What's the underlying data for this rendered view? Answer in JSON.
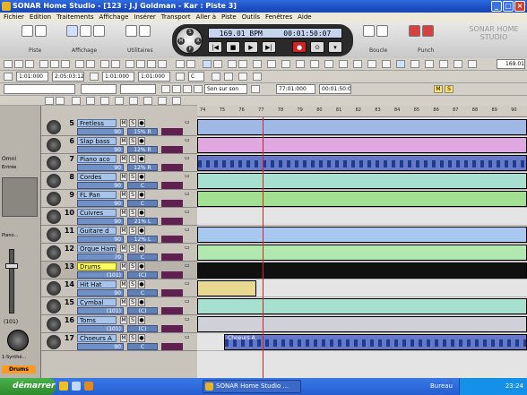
{
  "window": {
    "title": "SONAR Home Studio - [123 : J.J Goldman - Kar : Piste 3]"
  },
  "menu": [
    "Fichier",
    "Edition",
    "Traitements",
    "Affichage",
    "Insérer",
    "Transport",
    "Aller à",
    "Piste",
    "Outils",
    "Fenêtres",
    "Aide"
  ],
  "toolbar": {
    "groups": [
      {
        "label": "Piste"
      },
      {
        "label": "Affichage"
      },
      {
        "label": "Utilitaires"
      },
      {
        "label": "Boucle"
      },
      {
        "label": "Punch"
      }
    ],
    "brand": "SONAR HOME STUDIO"
  },
  "transport": {
    "tempo": "169.01 BPM",
    "time": "00:01:50:07",
    "knob_letters": [
      "S",
      "M",
      "R",
      "P"
    ]
  },
  "edit_row": {
    "field1": "1:01:000",
    "field2": "2:05:03:126",
    "field3": "1:01:000",
    "field4": "1:01:000",
    "field5": "C",
    "right_value": "169.01"
  },
  "row2": {
    "sound": "Son sur son",
    "time1": "77:01:000",
    "time2": "00:01:50:07",
    "mute_label": "M",
    "solo_label": "S"
  },
  "left_panel": {
    "label1": "Omni",
    "label2": "Entrée",
    "label3": "Piano...",
    "value_bottom": "(101)",
    "bottom_name": "1-Synthé...",
    "bottom_tag": "Drums"
  },
  "tracks": [
    {
      "num": "5",
      "name": "Fretless",
      "vol": "90",
      "pan": "15% R",
      "selected": false
    },
    {
      "num": "6",
      "name": "Slap bass",
      "vol": "90",
      "pan": "12% R",
      "selected": false
    },
    {
      "num": "7",
      "name": "Piano aco",
      "vol": "90",
      "pan": "12% R",
      "selected": false
    },
    {
      "num": "8",
      "name": "Cordes",
      "vol": "90",
      "pan": "C",
      "selected": false
    },
    {
      "num": "9",
      "name": "FL Pan",
      "vol": "90",
      "pan": "C",
      "selected": false
    },
    {
      "num": "10",
      "name": "Cuivres",
      "vol": "90",
      "pan": "21% L",
      "selected": false
    },
    {
      "num": "11",
      "name": "Guitare d",
      "vol": "90",
      "pan": "12% L",
      "selected": false
    },
    {
      "num": "12",
      "name": "Orgue Ham",
      "vol": "70",
      "pan": "C",
      "selected": false
    },
    {
      "num": "13",
      "name": "Drums",
      "vol": "(101)",
      "pan": "(C)",
      "selected": true
    },
    {
      "num": "14",
      "name": "Hit Hat",
      "vol": "90",
      "pan": "C",
      "selected": false
    },
    {
      "num": "15",
      "name": "Cymbal",
      "vol": "(101)",
      "pan": "(C)",
      "selected": false
    },
    {
      "num": "16",
      "name": "Toms",
      "vol": "(101)",
      "pan": "(C)",
      "selected": false
    },
    {
      "num": "17",
      "name": "Choeurs A",
      "vol": "90",
      "pan": "C",
      "selected": false
    }
  ],
  "ruler": [
    "74",
    "75",
    "76",
    "77",
    "78",
    "79",
    "80",
    "81",
    "82",
    "83",
    "84",
    "85",
    "86",
    "87",
    "88",
    "89",
    "90"
  ],
  "clip_label": "Choeurs A",
  "taskbar": {
    "start": "démarrer",
    "app": "SONAR Home Studio ...",
    "desktop": "Bureau",
    "clock": "23:24"
  },
  "colors": {
    "title_blue": "#1d4fc4",
    "selected_track": "#ffff60",
    "record_red": "#d92020"
  }
}
